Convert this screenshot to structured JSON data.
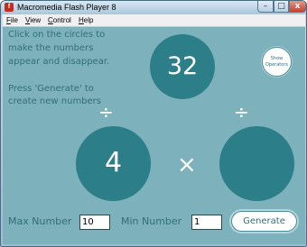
{
  "window": {
    "title": "Macromedia Flash Player 8",
    "app_icon_glyph": "f",
    "controls": {
      "minimize": "–",
      "maximize": "□",
      "close": "x"
    }
  },
  "menu": {
    "items": [
      {
        "key": "F",
        "rest": "ile"
      },
      {
        "key": "V",
        "rest": "iew"
      },
      {
        "key": "C",
        "rest": "ontrol"
      },
      {
        "key": "H",
        "rest": "elp"
      }
    ]
  },
  "stage": {
    "background_color": "#7db1bb",
    "circle_color": "#2c7f89",
    "text_color": "#2f6f7c",
    "instructions": [
      "Click on the circles to",
      "make the numbers",
      "appear and disappear.",
      "",
      "Press 'Generate' to",
      "create new numbers"
    ],
    "circles": {
      "top": "32",
      "left": "4",
      "right": ""
    },
    "operators": {
      "left_divide": "÷",
      "right_divide": "÷",
      "times": "×"
    },
    "show_operators": {
      "line1": "Show",
      "line2": "Operators"
    },
    "max_number": {
      "label": "Max Number",
      "value": "10"
    },
    "min_number": {
      "label": "Min Number",
      "value": "1"
    },
    "generate_label": "Generate"
  }
}
